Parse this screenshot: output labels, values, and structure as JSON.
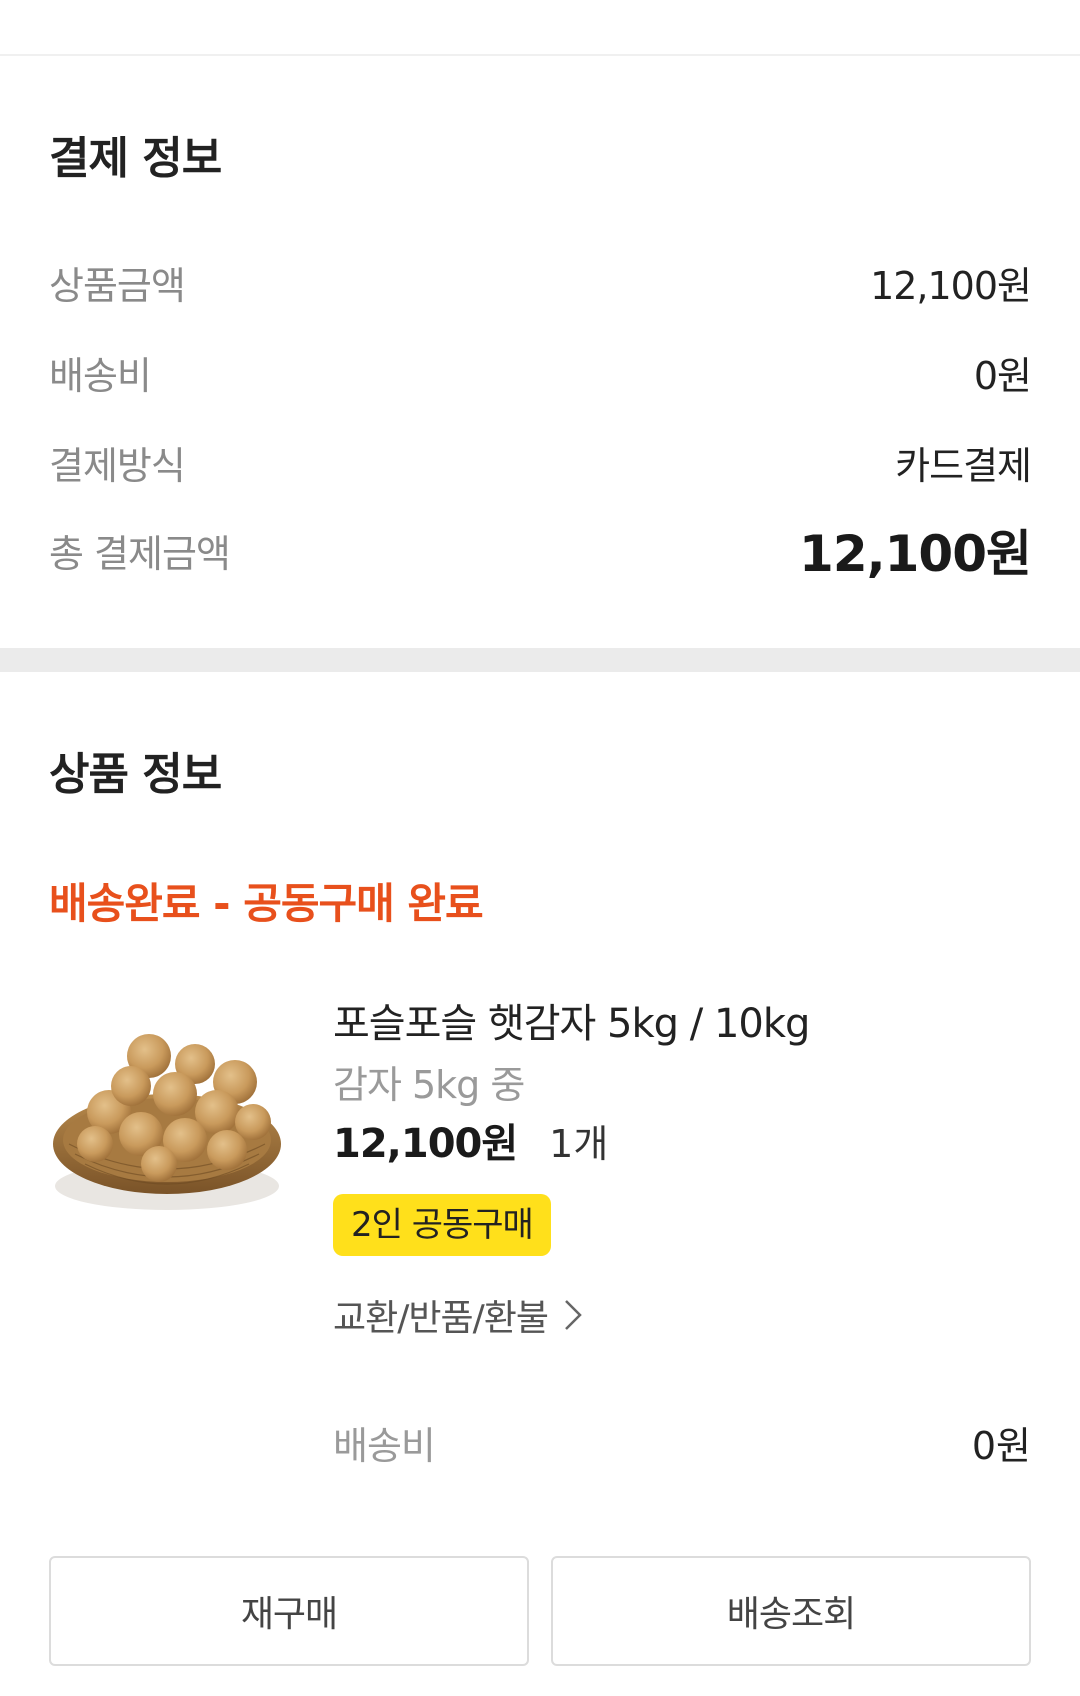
{
  "payment_info": {
    "title": "결제 정보",
    "rows": [
      {
        "label": "상품금액",
        "value": "12,100원"
      },
      {
        "label": "배송비",
        "value": "0원"
      },
      {
        "label": "결제방식",
        "value": "카드결제"
      },
      {
        "label": "총 결제금액",
        "value": "12,100원"
      }
    ]
  },
  "product_info": {
    "title": "상품 정보",
    "status": "배송완료 - 공동구매 완료",
    "item": {
      "image_icon": "potato-basket-image",
      "name": "포슬포슬 햇감자 5kg / 10kg",
      "option": "감자 5kg 중",
      "price": "12,100원",
      "quantity": "1개",
      "badge": "2인 공동구매",
      "exchange_link": "교환/반품/환불"
    },
    "shipping": {
      "label": "배송비",
      "value": "0원"
    },
    "buttons": {
      "rebuy": "재구매",
      "track": "배송조회"
    }
  },
  "colors": {
    "status": "#e8501c",
    "badge": "#ffe01b",
    "divider": "#ebebeb"
  }
}
